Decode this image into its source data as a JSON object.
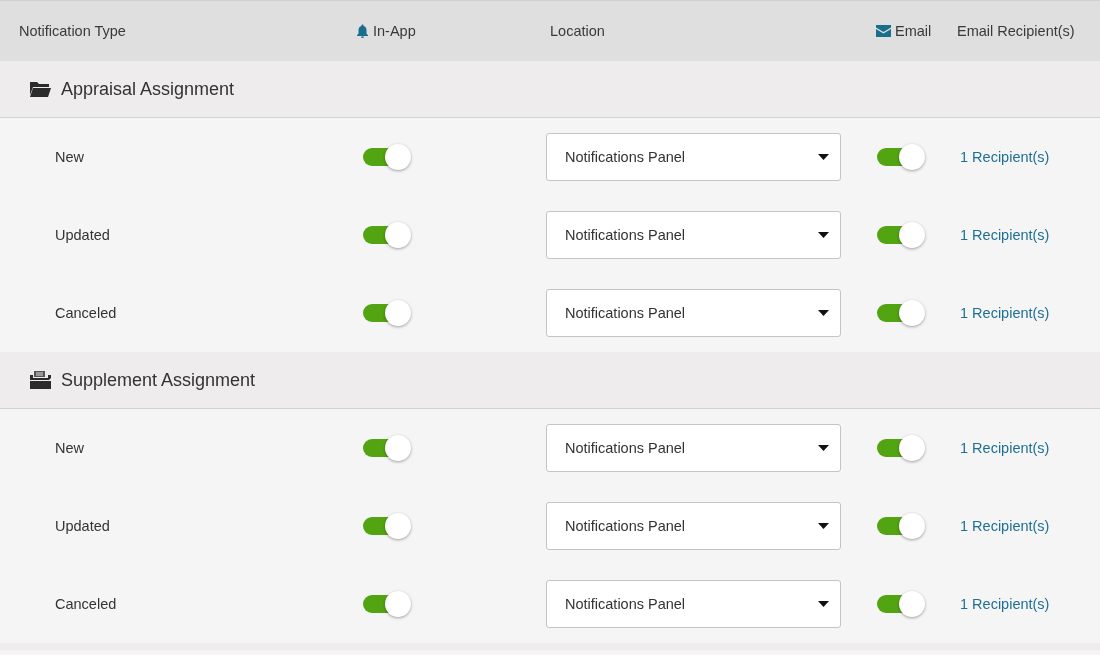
{
  "header": {
    "columns": [
      "Notification Type",
      "In-App",
      "Location",
      "Email",
      "Email Recipient(s)"
    ]
  },
  "groups": [
    {
      "title": "Appraisal Assignment",
      "rows": [
        {
          "name": "New",
          "in_app": true,
          "location": "Notifications Panel",
          "email": true,
          "recipients": "1 Recipient(s)"
        },
        {
          "name": "Updated",
          "in_app": true,
          "location": "Notifications Panel",
          "email": true,
          "recipients": "1 Recipient(s)"
        },
        {
          "name": "Canceled",
          "in_app": true,
          "location": "Notifications Panel",
          "email": true,
          "recipients": "1 Recipient(s)"
        }
      ]
    },
    {
      "title": "Supplement Assignment",
      "rows": [
        {
          "name": "New",
          "in_app": true,
          "location": "Notifications Panel",
          "email": true,
          "recipients": "1 Recipient(s)"
        },
        {
          "name": "Updated",
          "in_app": true,
          "location": "Notifications Panel",
          "email": true,
          "recipients": "1 Recipient(s)"
        },
        {
          "name": "Canceled",
          "in_app": true,
          "location": "Notifications Panel",
          "email": true,
          "recipients": "1 Recipient(s)"
        }
      ]
    }
  ]
}
